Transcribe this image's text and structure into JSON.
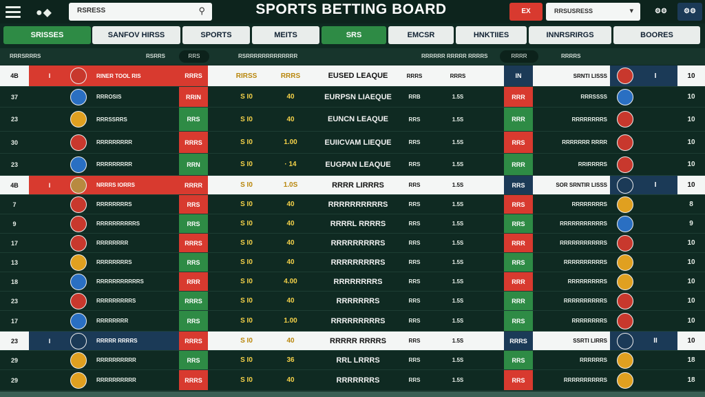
{
  "header": {
    "title": "SPORTS BETTING BOARD",
    "search_text": "RSRESS",
    "red_button": "EX",
    "select_text": "RRSUSRESS",
    "icon_btn_1": "⚙⚙",
    "icon_btn_2": "⚙⚙"
  },
  "tabs": [
    {
      "label": "SRISSES"
    },
    {
      "label": "SANFOV HIRSS"
    },
    {
      "label": "SPORTS"
    },
    {
      "label": "MEITS"
    },
    {
      "label": "SRS"
    },
    {
      "label": "EMCSR"
    },
    {
      "label": "HNKTIIES"
    },
    {
      "label": "INNRSRIRGS"
    },
    {
      "label": "BOORES"
    }
  ],
  "subheader": {
    "c1": "RRRSRRRS",
    "c2": "RSRRS",
    "pill1": "RRS",
    "c3": "RSRRRRRRRRRRRRR",
    "c4": "RRRRRR RRRRR RRRRS",
    "pill2": "RRRR",
    "c5": "RRRRS"
  },
  "rows": [
    {
      "num": "4B",
      "mark": "I",
      "flag": "#c8382d",
      "team": "RINER TOOL RIS",
      "stake": "RRRS",
      "odd1": "RIRSS",
      "odd2": "RRRS",
      "league": "EUSED LEAQUE",
      "m1": "RRRS",
      "m2": "RRRS",
      "stake2": "IN",
      "rname": "SRNTI LISSS",
      "flag2": "#c8382d",
      "rmark": "I",
      "count": "10",
      "hl": "left-red right-white"
    },
    {
      "num": "37",
      "mark": "",
      "flag": "#2a6fc2",
      "team": "RRROSIS",
      "stake": "RRIN",
      "odd1": "S I0",
      "odd2": "40",
      "league": "EURPSN LIAEQUE",
      "m1": "RRB",
      "m2": "1.5S",
      "stake2": "RRR",
      "rname": "RRRSSSS",
      "flag2": "#2a6fc2",
      "rmark": "",
      "count": "10",
      "hl": "red"
    },
    {
      "num": "23",
      "mark": "",
      "flag": "#e0a020",
      "team": "RRRSSRRS",
      "stake": "RRS",
      "odd1": "S I0",
      "odd2": "40",
      "league": "EUNCN LEAQUE",
      "m1": "RRS",
      "m2": "1.5S",
      "stake2": "RRR",
      "rname": "RRRRRRRRS",
      "flag2": "#c8382d",
      "rmark": "",
      "count": "10",
      "hl": "green"
    },
    {
      "num": "30",
      "mark": "",
      "flag": "#c8382d",
      "team": "RRRRRRRRR",
      "stake": "RRRS",
      "odd1": "S I0",
      "odd2": "1.00",
      "league": "EUIICVAM LIEQUE",
      "m1": "RRS",
      "m2": "1.5S",
      "stake2": "RRS",
      "rname": "RRRRRRR RRRR",
      "flag2": "#c8382d",
      "rmark": "",
      "count": "10",
      "hl": "red"
    },
    {
      "num": "23",
      "mark": "",
      "flag": "#2a6fc2",
      "team": "RRRRRRRRR",
      "stake": "RRN",
      "odd1": "S I0",
      "odd2": "· 14",
      "league": "EUGPAN LEAQUE",
      "m1": "RRS",
      "m2": "1.5S",
      "stake2": "RRR",
      "rname": "RRIRRRRS",
      "flag2": "#c8382d",
      "rmark": "",
      "count": "10",
      "hl": "green"
    },
    {
      "num": "4B",
      "mark": "I",
      "flag": "#b88a40",
      "team": "NRRRS IORRS",
      "stake": "RRRR",
      "odd1": "S I0",
      "odd2": "1.0S",
      "league": "RRRR LIRRRS",
      "m1": "RRS",
      "m2": "1.5S",
      "stake2": "RRS",
      "rname": "SOR SRNTIR LISSS",
      "flag2": "#1b3a57",
      "rmark": "I",
      "count": "10",
      "hl": "left-red right-white"
    },
    {
      "num": "7",
      "mark": "",
      "flag": "#c8382d",
      "team": "RRRRRRRRS",
      "stake": "RRS",
      "odd1": "S I0",
      "odd2": "40",
      "league": "RRRRRRRRRRS",
      "m1": "RRS",
      "m2": "1.5S",
      "stake2": "RRS",
      "rname": "RRRRRRRRS",
      "flag2": "#e0a020",
      "rmark": "",
      "count": "8",
      "hl": "red"
    },
    {
      "num": "9",
      "mark": "",
      "flag": "#c8382d",
      "team": "RRRRRRRRRRS",
      "stake": "RRS",
      "odd1": "S I0",
      "odd2": "40",
      "league": "RRRRL RRRRS",
      "m1": "RRS",
      "m2": "1.5S",
      "stake2": "RRS",
      "rname": "RRRRRRRRRRRS",
      "flag2": "#2a6fc2",
      "rmark": "",
      "count": "9",
      "hl": "green"
    },
    {
      "num": "17",
      "mark": "",
      "flag": "#c8382d",
      "team": "RRRRRRRR",
      "stake": "RRRS",
      "odd1": "S I0",
      "odd2": "40",
      "league": "RRRRRRRRRS",
      "m1": "RRS",
      "m2": "1.5S",
      "stake2": "RRR",
      "rname": "RRRRRRRRRRRS",
      "flag2": "#c8382d",
      "rmark": "",
      "count": "10",
      "hl": "red"
    },
    {
      "num": "13",
      "mark": "",
      "flag": "#e0a020",
      "team": "RRRRRRRRS",
      "stake": "RRS",
      "odd1": "S I0",
      "odd2": "40",
      "league": "RRRRRRRRRS",
      "m1": "RRS",
      "m2": "1.5S",
      "stake2": "RRS",
      "rname": "RRRRRRRRRRS",
      "flag2": "#e0a020",
      "rmark": "",
      "count": "10",
      "hl": "green"
    },
    {
      "num": "18",
      "mark": "",
      "flag": "#2a6fc2",
      "team": "RRRRRRRRRRRS",
      "stake": "RRR",
      "odd1": "S I0",
      "odd2": "4.00",
      "league": "RRRRRRRRS",
      "m1": "RRS",
      "m2": "1.5S",
      "stake2": "RRR",
      "rname": "RRRRRRRRRS",
      "flag2": "#e0a020",
      "rmark": "",
      "count": "10",
      "hl": "red"
    },
    {
      "num": "23",
      "mark": "",
      "flag": "#c8382d",
      "team": "RRRRRRRRRS",
      "stake": "RRRS",
      "odd1": "S I0",
      "odd2": "40",
      "league": "RRRRRRRS",
      "m1": "RRS",
      "m2": "1.5S",
      "stake2": "RRR",
      "rname": "RRRRRRRRRRS",
      "flag2": "#c8382d",
      "rmark": "",
      "count": "10",
      "hl": "green"
    },
    {
      "num": "17",
      "mark": "",
      "flag": "#2a6fc2",
      "team": "RRRRRRRR",
      "stake": "RRS",
      "odd1": "S I0",
      "odd2": "1.00",
      "league": "RRRRRRRRRS",
      "m1": "RRS",
      "m2": "1.5S",
      "stake2": "RRS",
      "rname": "RRRRRRRRS",
      "flag2": "#c8382d",
      "rmark": "",
      "count": "10",
      "hl": "green"
    },
    {
      "num": "23",
      "mark": "I",
      "flag": "#1b3a57",
      "team": "RRRRR RRRRS",
      "stake": "RRRS",
      "odd1": "S I0",
      "odd2": "40",
      "league": "RRRRR RRRRS",
      "m1": "RRS",
      "m2": "1.5S",
      "stake2": "RRRS",
      "rname": "SSRTI LIRRS",
      "flag2": "#1b3a57",
      "rmark": "II",
      "count": "10",
      "hl": "left-blue right-white"
    },
    {
      "num": "29",
      "mark": "",
      "flag": "#e0a020",
      "team": "RRRRRRRRRR",
      "stake": "RRS",
      "odd1": "S I0",
      "odd2": "36",
      "league": "RRL LRRRS",
      "m1": "RRS",
      "m2": "1.5S",
      "stake2": "RRS",
      "rname": "RRRRRRS",
      "flag2": "#e0a020",
      "rmark": "",
      "count": "18",
      "hl": "green"
    },
    {
      "num": "29",
      "mark": "",
      "flag": "#e0a020",
      "team": "RRRRRRRRRR",
      "stake": "RRRS",
      "odd1": "S I0",
      "odd2": "40",
      "league": "RRRRRRRS",
      "m1": "RRS",
      "m2": "1.5S",
      "stake2": "RRS",
      "rname": "RRRRRRRRRRS",
      "flag2": "#e0a020",
      "rmark": "",
      "count": "18",
      "hl": "red"
    }
  ],
  "colors": {
    "red": "#d83a2f",
    "green": "#2e8b45",
    "navy": "#1b3a57",
    "bg": "#0f2a22"
  }
}
